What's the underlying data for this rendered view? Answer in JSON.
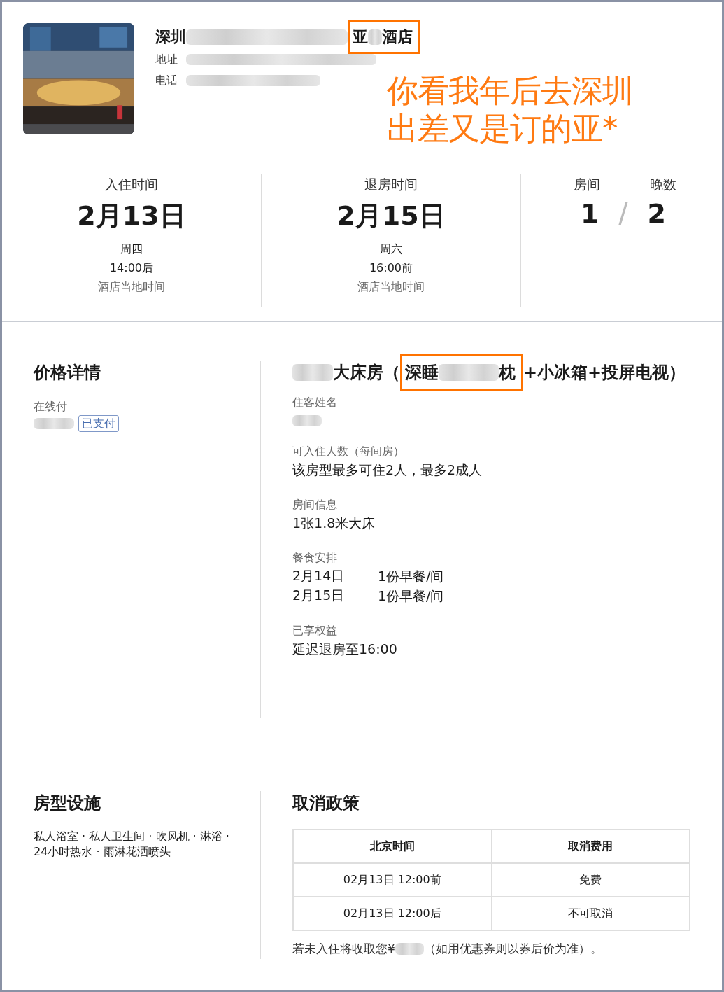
{
  "hotel": {
    "name": [
      {
        "kind": "text",
        "text": "深圳"
      },
      {
        "kind": "redacted"
      },
      {
        "kind": "mark",
        "parts": [
          {
            "kind": "text",
            "text": "亚"
          },
          {
            "kind": "redacted"
          },
          {
            "kind": "text",
            "text": "酒店"
          }
        ]
      }
    ],
    "address_label": "地址",
    "phone_label": "电话"
  },
  "annotation": [
    "你看我年后去深圳",
    "出差又是订的亚*"
  ],
  "stay": {
    "checkin": {
      "label": "入住时间",
      "date": "2月13日",
      "weekday": "周四",
      "time": "14:00后",
      "note": "酒店当地时间"
    },
    "checkout": {
      "label": "退房时间",
      "date": "2月15日",
      "weekday": "周六",
      "time": "16:00前",
      "note": "酒店当地时间"
    },
    "rooms_label": "房间",
    "nights_label": "晚数",
    "rooms": "1",
    "separator": "/",
    "nights": "2"
  },
  "price": {
    "title": "价格详情",
    "method": "在线付",
    "tag": "已支付"
  },
  "room": {
    "title": [
      {
        "kind": "redacted"
      },
      {
        "kind": "text",
        "text": "大床房（"
      },
      {
        "kind": "mark",
        "parts": [
          {
            "kind": "text",
            "text": "深睡"
          },
          {
            "kind": "redacted"
          },
          {
            "kind": "text",
            "text": "枕"
          }
        ]
      },
      {
        "kind": "text",
        "text": "+小冰箱+投屏电视）"
      }
    ],
    "details": [
      {
        "kind": "redacted",
        "label": "住客姓名"
      },
      {
        "kind": "text",
        "label": "可入住人数（每间房）",
        "value": "该房型最多可住2人，最多2成人"
      },
      {
        "kind": "text",
        "label": "房间信息",
        "value": "1张1.8米大床"
      },
      {
        "kind": "meals",
        "label": "餐食安排",
        "rows": [
          {
            "date": "2月14日",
            "meal": "1份早餐/间"
          },
          {
            "date": "2月15日",
            "meal": "1份早餐/间"
          }
        ]
      },
      {
        "kind": "text",
        "label": "已享权益",
        "value": "延迟退房至16:00"
      }
    ]
  },
  "facilities": {
    "title": "房型设施",
    "text": "私人浴室 · 私人卫生间 · 吹风机 · 淋浴 · 24小时热水 · 雨淋花洒喷头"
  },
  "cancellation": {
    "title": "取消政策",
    "columns": [
      "北京时间",
      "取消费用"
    ],
    "rows": [
      [
        "02月13日 12:00前",
        "免费"
      ],
      [
        "02月13日 12:00后",
        "不可取消"
      ]
    ],
    "note": [
      {
        "kind": "text",
        "text": "若未入住将收取您¥"
      },
      {
        "kind": "redacted"
      },
      {
        "kind": "text",
        "text": "（如用优惠券则以券后价为准）。"
      }
    ]
  }
}
